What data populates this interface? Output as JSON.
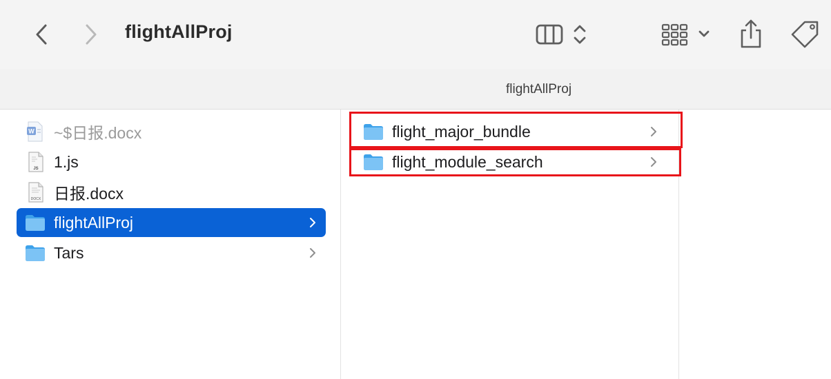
{
  "window": {
    "title": "flightAllProj"
  },
  "toolbar": {
    "back_icon": "chevron-left-icon",
    "forward_icon": "chevron-right-icon",
    "view_icon": "column-view-icon",
    "group_icon": "grid-group-icon",
    "share_icon": "share-icon",
    "tag_icon": "tag-icon"
  },
  "pathbar": {
    "title": "flightAllProj"
  },
  "column1": {
    "items": [
      {
        "label": "~$日报.docx",
        "icon": "word-document-icon",
        "dimmed": true,
        "has_children": false,
        "selected": false
      },
      {
        "label": "1.js",
        "icon": "js-file-icon",
        "dimmed": false,
        "has_children": false,
        "selected": false
      },
      {
        "label": "日报.docx",
        "icon": "docx-file-icon",
        "dimmed": false,
        "has_children": false,
        "selected": false
      },
      {
        "label": "flightAllProj",
        "icon": "folder-icon",
        "dimmed": false,
        "has_children": true,
        "selected": true
      },
      {
        "label": "Tars",
        "icon": "folder-icon",
        "dimmed": false,
        "has_children": true,
        "selected": false
      }
    ]
  },
  "column2": {
    "items": [
      {
        "label": "flight_major_bundle",
        "icon": "folder-icon",
        "has_children": true,
        "highlighted": true
      },
      {
        "label": "flight_module_search",
        "icon": "folder-icon",
        "has_children": true,
        "highlighted": true
      }
    ]
  },
  "colors": {
    "selection": "#0a62d6",
    "highlight_border": "#e8141a",
    "folder_light": "#7cc3f5",
    "folder_dark": "#3ea2ea"
  }
}
